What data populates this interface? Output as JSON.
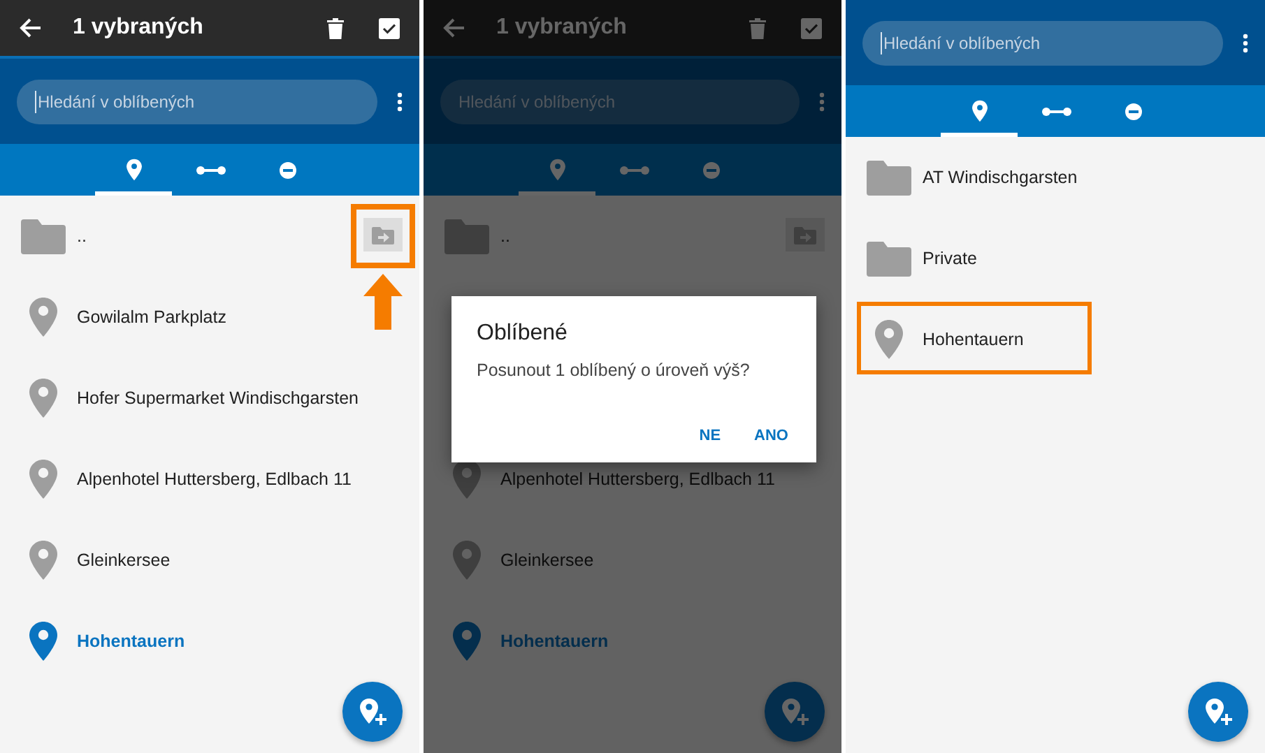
{
  "panels": [
    {
      "toolbar": {
        "title": "1 vybraných"
      },
      "search": {
        "placeholder": "Hledání v oblíbených",
        "focused": true
      },
      "tabs": [
        {
          "kind": "points",
          "selected": true
        },
        {
          "kind": "tracks",
          "selected": false
        },
        {
          "kind": "recordings",
          "selected": false
        }
      ],
      "items": [
        {
          "kind": "parent",
          "label": "..",
          "move_button_highlighted": true
        },
        {
          "kind": "place",
          "label": "Gowilalm Parkplatz",
          "selected": false,
          "highlighted": false
        },
        {
          "kind": "place",
          "label": "Hofer Supermarket Windischgarsten",
          "selected": false,
          "highlighted": false
        },
        {
          "kind": "place",
          "label": "Alpenhotel Huttersberg, Edlbach 11",
          "selected": false,
          "highlighted": false
        },
        {
          "kind": "place",
          "label": "Gleinkersee",
          "selected": false,
          "highlighted": false
        },
        {
          "kind": "place",
          "label": "Hohentauern",
          "selected": true,
          "highlighted": false
        }
      ]
    },
    {
      "toolbar": {
        "title": "1 vybraných"
      },
      "dimmed": true,
      "search": {
        "placeholder": "Hledání v oblíbených"
      },
      "tabs": [
        {
          "kind": "points",
          "selected": true
        },
        {
          "kind": "tracks",
          "selected": false
        },
        {
          "kind": "recordings",
          "selected": false
        }
      ],
      "items": [
        {
          "kind": "parent",
          "label": ".."
        },
        {
          "kind": "covered"
        },
        {
          "kind": "covered"
        },
        {
          "kind": "place",
          "label": "Alpenhotel Huttersberg, Edlbach 11",
          "selected": false,
          "highlighted": false
        },
        {
          "kind": "place",
          "label": "Gleinkersee",
          "selected": false,
          "highlighted": false
        },
        {
          "kind": "place",
          "label": "Hohentauern",
          "selected": true,
          "highlighted": false
        }
      ],
      "dialog": {
        "title": "Oblíbené",
        "message": "Posunout 1 oblíbený o úroveň výš?",
        "buttons": [
          "NE",
          "ANO"
        ]
      }
    },
    {
      "search": {
        "placeholder": "Hledání v oblíbených",
        "focused": true
      },
      "tabs": [
        {
          "kind": "points",
          "selected": true
        },
        {
          "kind": "tracks",
          "selected": false
        },
        {
          "kind": "recordings",
          "selected": false
        }
      ],
      "items": [
        {
          "kind": "folder",
          "label": "AT Windischgarsten"
        },
        {
          "kind": "folder",
          "label": "Private"
        },
        {
          "kind": "place",
          "label": "Hohentauern",
          "selected": false,
          "highlighted": true
        }
      ]
    }
  ]
}
